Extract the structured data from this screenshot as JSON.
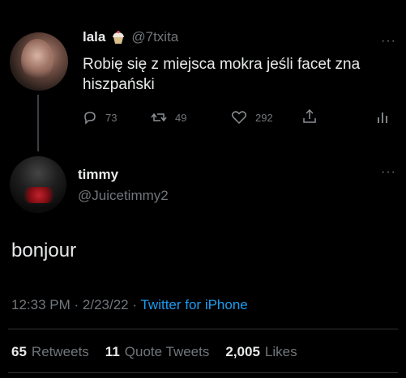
{
  "tweet1": {
    "name": "lala",
    "handle": "@7txita",
    "text": "Robię się z miejsca mokra jeśli facet zna hiszpański",
    "actions": {
      "replies": "73",
      "retweets": "49",
      "likes": "292"
    },
    "name_emoji": "cupcake-icon"
  },
  "tweet2": {
    "name": "timmy",
    "handle": "@Juicetimmy2",
    "text": "bonjour",
    "time": "12:33 PM",
    "date": "2/23/22",
    "sep": "·",
    "source": "Twitter for iPhone"
  },
  "stats": {
    "retweets_count": "65",
    "retweets_label": "Retweets",
    "quote_count": "11",
    "quote_label": "Quote Tweets",
    "likes_count": "2,005",
    "likes_label": "Likes"
  },
  "colors": {
    "background": "#000000",
    "text": "#e7e9ea",
    "muted": "#71767b",
    "link": "#1d9bf0"
  }
}
